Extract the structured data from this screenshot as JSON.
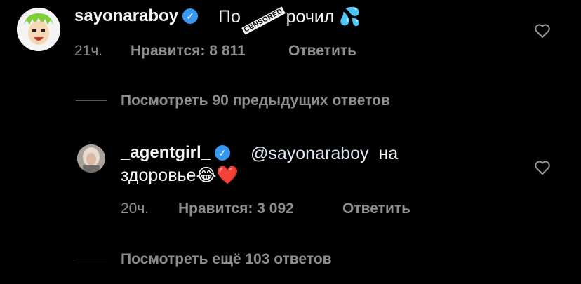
{
  "comment1": {
    "username": "sayonaraboy",
    "text_part1": "По",
    "text_part2": "рочил",
    "censored_label": "CENSORED",
    "emoji": "💦",
    "time": "21ч.",
    "likes_label": "Нравится: 8 811",
    "reply_label": "Ответить",
    "view_replies": "Посмотреть 90 предыдущих ответов"
  },
  "comment2": {
    "username": "_agentgirl_",
    "mention": "@sayonaraboy",
    "text_line1_rest": "на",
    "text_line2": "здоровье",
    "emoji_laugh": "😂",
    "emoji_heart": "❤️",
    "time": "20ч.",
    "likes_label": "Нравится: 3 092",
    "reply_label": "Ответить",
    "view_more": "Посмотреть ещё 103 ответов"
  },
  "colors": {
    "background": "#000000",
    "text_primary": "#f5f5f5",
    "text_secondary": "#8e8e8e",
    "verified": "#3897f0"
  }
}
